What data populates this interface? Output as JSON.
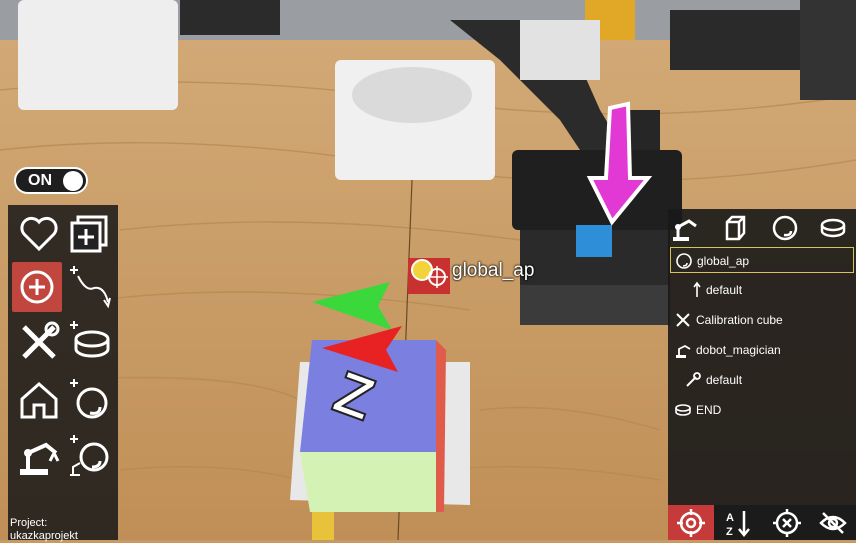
{
  "toggle": {
    "label": "ON"
  },
  "left_toolbar": {
    "tools": [
      {
        "icon": "heart-icon"
      },
      {
        "icon": "add-box-icon"
      },
      {
        "icon": "add-circle-icon",
        "active": true
      },
      {
        "icon": "add-path-icon"
      },
      {
        "icon": "tools-icon"
      },
      {
        "icon": "add-disc-icon"
      },
      {
        "icon": "home-icon"
      },
      {
        "icon": "add-orientation-icon"
      },
      {
        "icon": "robot-arm-icon"
      },
      {
        "icon": "add-robot-orientation-icon"
      }
    ],
    "project_label": "Project:",
    "project_name": "ukazkaprojekt"
  },
  "scene": {
    "action_point_label": "global_ap",
    "cube_letter": "Z"
  },
  "right_panel": {
    "header_icons": [
      "robot-arm-icon",
      "cube-icon",
      "circle-icon",
      "disc-icon"
    ],
    "tree": [
      {
        "label": "global_ap",
        "icon": "orientation-icon",
        "selected": true
      },
      {
        "label": "default",
        "icon": "arrow-up-icon"
      },
      {
        "label": "Calibration cube",
        "icon": "tools-icon"
      },
      {
        "label": "dobot_magician",
        "icon": "robot-arm-icon"
      },
      {
        "label": "default",
        "icon": "wrench-icon"
      },
      {
        "label": "END",
        "icon": "disc-icon"
      }
    ]
  },
  "bottom_toolbar": {
    "buttons": [
      {
        "icon": "target-icon",
        "active": true
      },
      {
        "icon": "sort-az-icon"
      },
      {
        "icon": "focus-icon"
      },
      {
        "icon": "hide-icon"
      }
    ]
  },
  "colors": {
    "accent_red": "#c73a3a",
    "selection_yellow": "#d8c35c",
    "panel_dark": "#181818"
  }
}
